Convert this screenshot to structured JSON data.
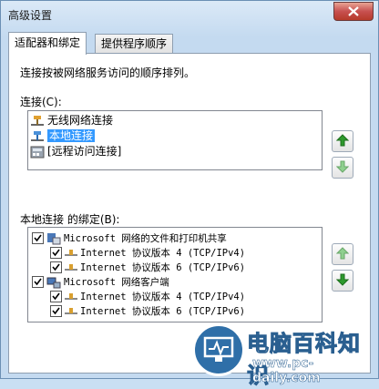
{
  "window": {
    "title": "高级设置"
  },
  "tabs": [
    {
      "label": "适配器和绑定"
    },
    {
      "label": "提供程序顺序"
    }
  ],
  "description": "连接按被网络服务访问的顺序排列。",
  "connections": {
    "label": "连接(C):",
    "items": [
      {
        "label": "无线网络连接",
        "selected": false,
        "icon": "network-icon"
      },
      {
        "label": "本地连接",
        "selected": true,
        "icon": "network-icon"
      },
      {
        "label": "[远程访问连接]",
        "selected": false,
        "icon": "remote-access-icon"
      }
    ]
  },
  "bindings": {
    "label": "本地连接 的绑定(B):",
    "groups": [
      {
        "label": "Microsoft 网络的文件和打印机共享",
        "checked": true,
        "icon": "file-printer-sharing-icon",
        "children": [
          {
            "label": "Internet 协议版本 4 (TCP/IPv4)",
            "checked": true
          },
          {
            "label": "Internet 协议版本 6 (TCP/IPv6)",
            "checked": true
          }
        ]
      },
      {
        "label": "Microsoft 网络客户端",
        "checked": true,
        "icon": "network-client-icon",
        "children": [
          {
            "label": "Internet 协议版本 4 (TCP/IPv4)",
            "checked": true
          },
          {
            "label": "Internet 协议版本 6 (TCP/IPv6)",
            "checked": true
          }
        ]
      }
    ]
  },
  "watermark": {
    "title": "电脑百科知识",
    "url": "www.pc-daily.com"
  },
  "colors": {
    "selection": "#3399ff",
    "arrow_green": "#2e9a2e",
    "close_red": "#c75050"
  }
}
